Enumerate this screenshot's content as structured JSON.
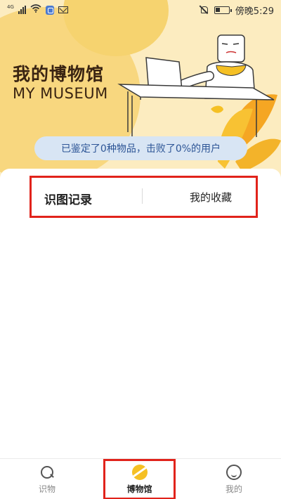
{
  "status_bar": {
    "network_label": "4G",
    "carrier_text": "傍晚5:29"
  },
  "header": {
    "title_cn": "我的博物馆",
    "title_en": "MY MUSEUM",
    "stat_text": "已鉴定了0种物品，击败了0%的用户"
  },
  "tabs": [
    {
      "label": "识图记录",
      "active": true
    },
    {
      "label": "我的收藏",
      "active": false
    }
  ],
  "bottom_nav": [
    {
      "label": "识物",
      "icon": "search-icon",
      "active": false
    },
    {
      "label": "博物馆",
      "icon": "museum-icon",
      "active": true
    },
    {
      "label": "我的",
      "icon": "profile-icon",
      "active": false
    }
  ],
  "colors": {
    "header_bg": "#fcecc0",
    "accent_yellow": "#f5c024",
    "highlight_red": "#e1231b",
    "stat_pill_bg": "#d8e5f4",
    "stat_text": "#2d5596"
  }
}
